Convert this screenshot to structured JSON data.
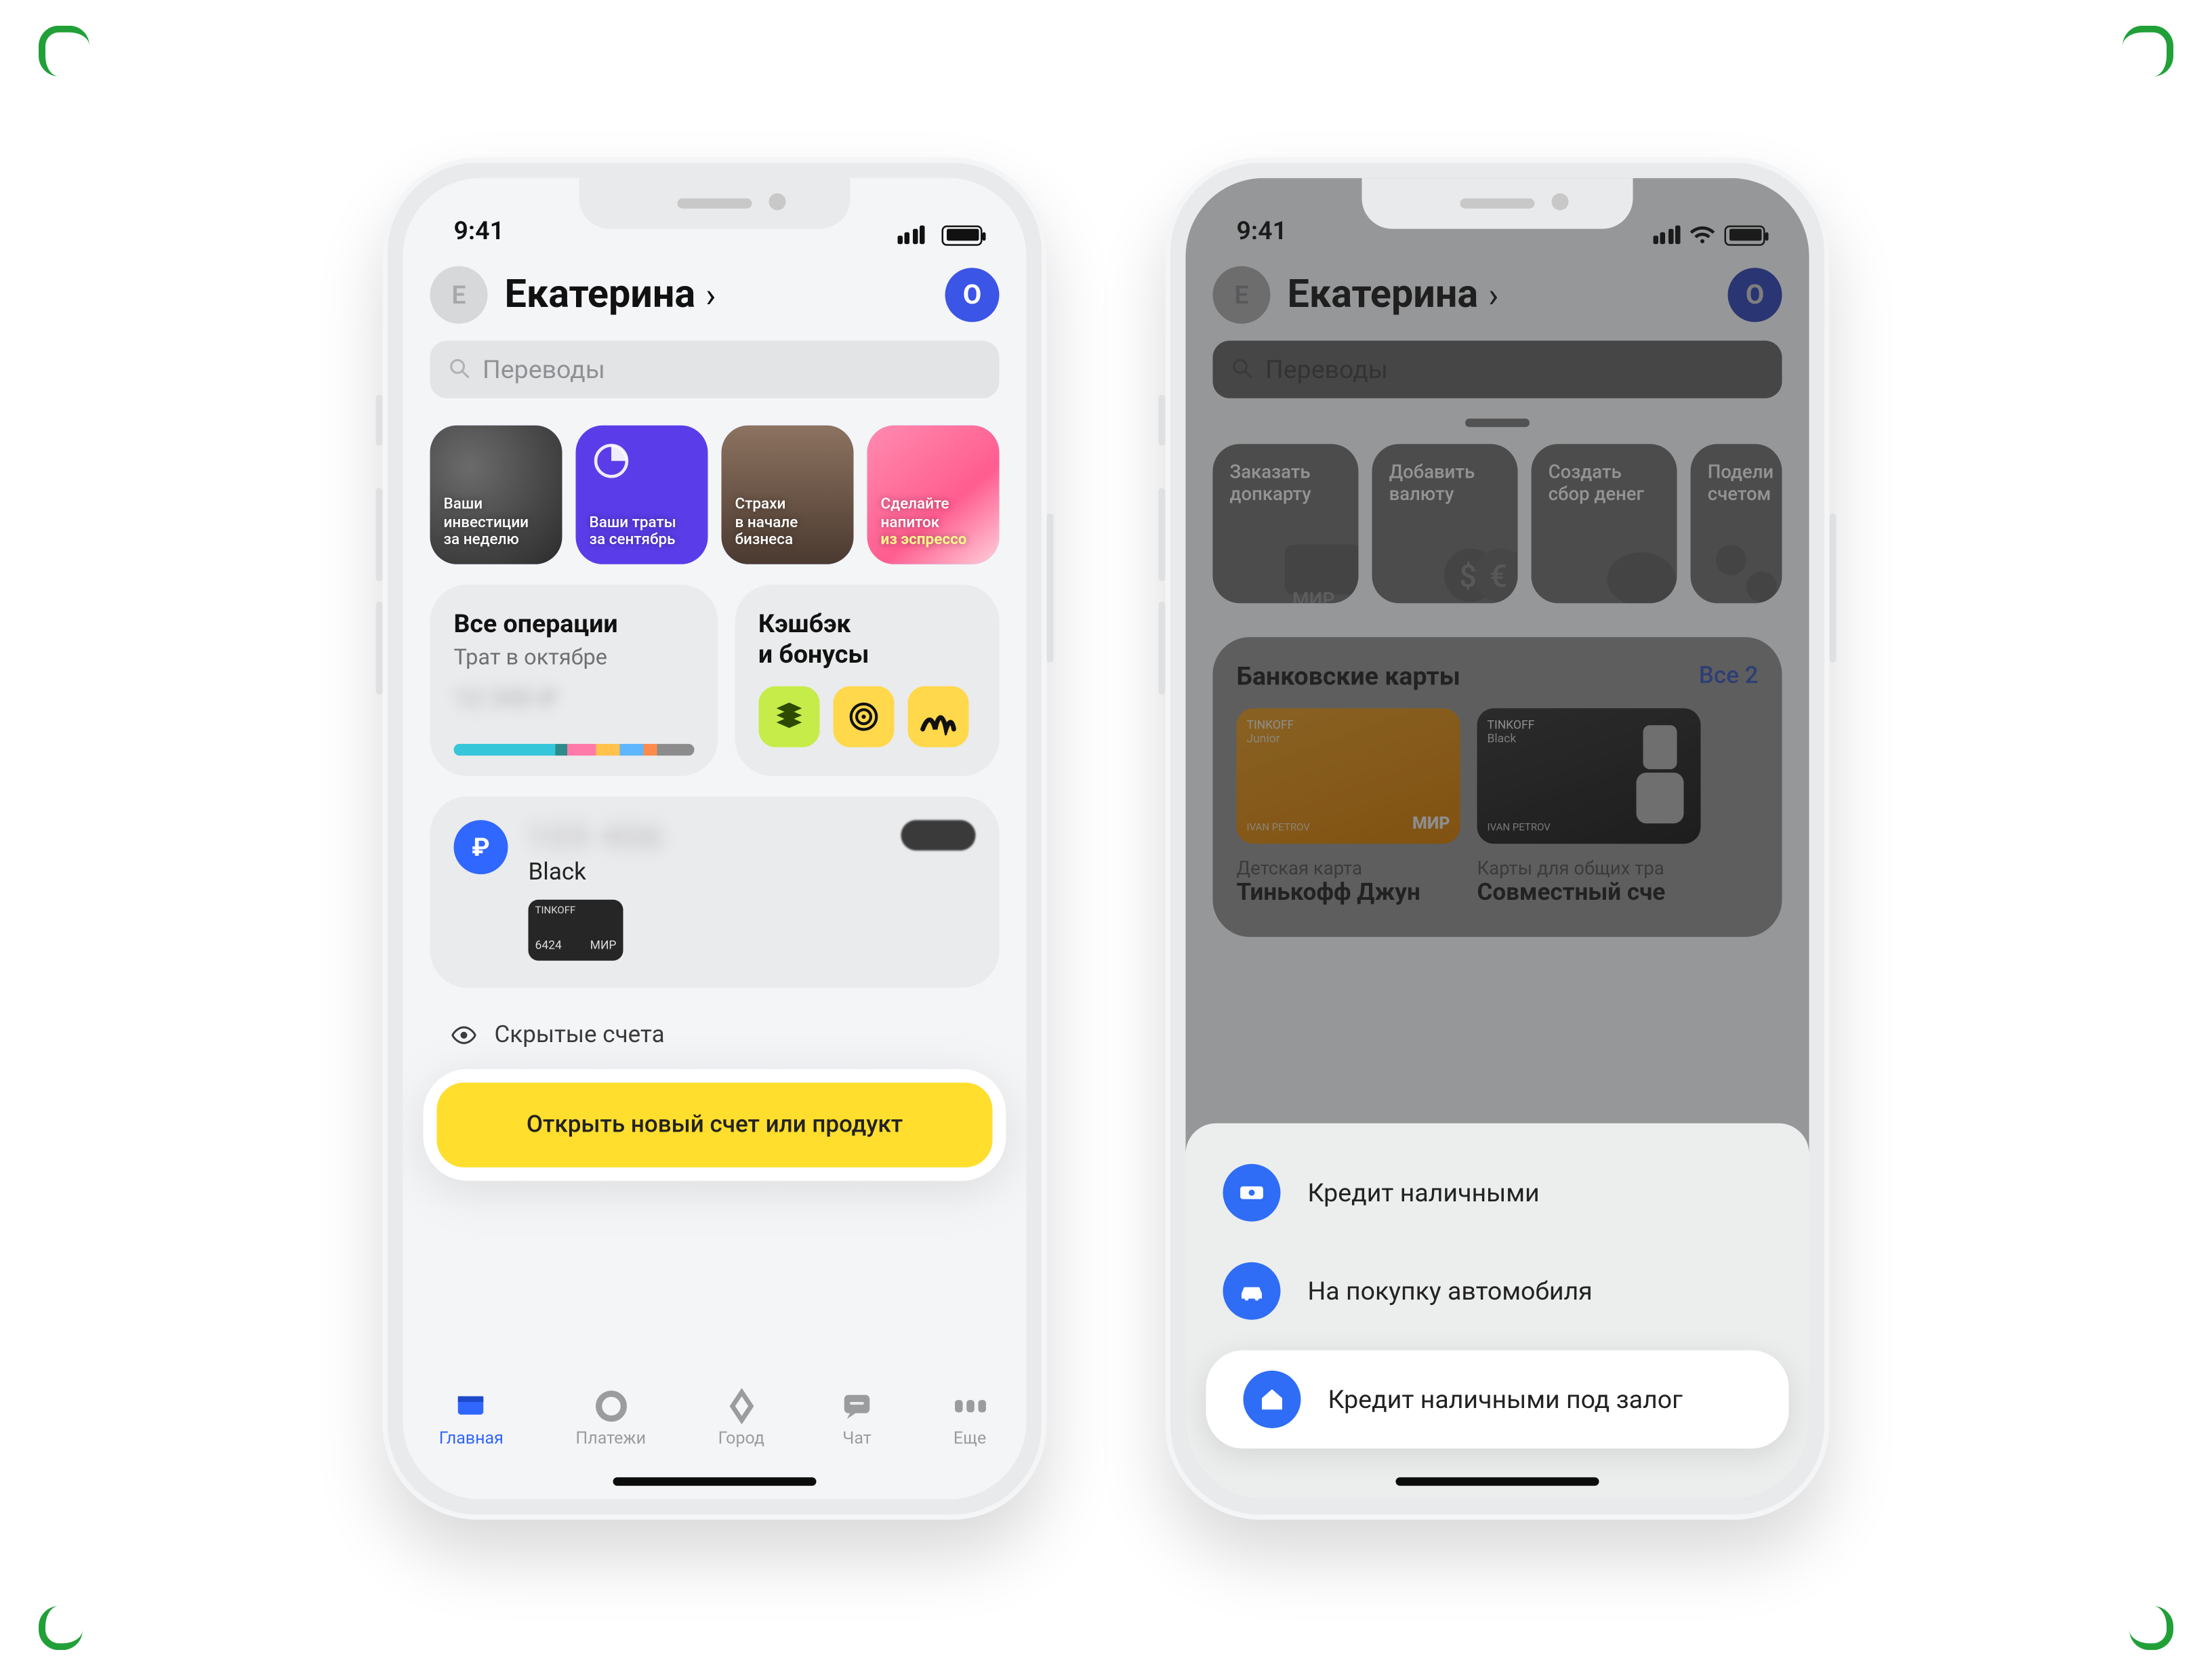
{
  "status": {
    "time": "9:41"
  },
  "header": {
    "avatar_initial": "Е",
    "user_name": "Екатерина",
    "badge_letter": "О",
    "search_placeholder": "Переводы"
  },
  "stories": [
    {
      "line1": "Ваши",
      "line2": "инвестиции",
      "line3": "за неделю"
    },
    {
      "line1": "Ваши траты",
      "line2": "за сентябрь"
    },
    {
      "line1": "Страхи",
      "line2": "в начале",
      "line3": "бизнеса"
    },
    {
      "line1": "Сделайте",
      "line2": "напиток",
      "line3_hl": "из эспрессо"
    }
  ],
  "ops_card": {
    "title": "Все операции",
    "subtitle": "Трат в октябре",
    "amount_masked": "12 345 ₽",
    "segments": [
      {
        "color": "#35c6d9",
        "w": 42
      },
      {
        "color": "#2f8a8a",
        "w": 5
      },
      {
        "color": "#ff7aa8",
        "w": 12
      },
      {
        "color": "#ffc24b",
        "w": 10
      },
      {
        "color": "#5db6ff",
        "w": 10
      },
      {
        "color": "#ff8b4b",
        "w": 6
      },
      {
        "color": "#8c8c8c",
        "w": 15
      }
    ]
  },
  "cashback_card": {
    "title_l1": "Кэшбэк",
    "title_l2": "и бонусы"
  },
  "account": {
    "name": "Black",
    "amount_masked": "123 456",
    "card_brand": "TINKOFF",
    "card_last4": "6424",
    "card_scheme": "МИР"
  },
  "hidden_accounts_label": "Скрытые счета",
  "cta_label": "Открыть новый счет или продукт",
  "tabs": [
    {
      "id": "home",
      "label": "Главная",
      "active": true
    },
    {
      "id": "payments",
      "label": "Платежи"
    },
    {
      "id": "city",
      "label": "Город"
    },
    {
      "id": "chat",
      "label": "Чат"
    },
    {
      "id": "more",
      "label": "Еще"
    }
  ],
  "phone2": {
    "actions": [
      {
        "l1": "Заказать",
        "l2": "допкарту"
      },
      {
        "l1": "Добавить",
        "l2": "валюту"
      },
      {
        "l1": "Создать",
        "l2": "сбор денег"
      },
      {
        "l1": "Подели",
        "l2": "счетом"
      }
    ],
    "cards_section": {
      "title": "Банковские карты",
      "all_label": "Все 2",
      "cards": [
        {
          "brand": "TINKOFF",
          "variant": "Junior",
          "holder": "IVAN PETROV",
          "scheme": "МИР",
          "subtitle": "Детская карта",
          "title": "Тинькофф Джун"
        },
        {
          "brand": "TINKOFF",
          "variant": "Black",
          "holder": "IVAN PETROV",
          "subtitle": "Карты для общих тра",
          "title": "Совместный сче"
        }
      ]
    },
    "sheet": [
      {
        "icon": "cash",
        "label": "Кредит наличными"
      },
      {
        "icon": "car",
        "label": "На покупку автомобиля"
      },
      {
        "icon": "house",
        "label": "Кредит наличными под залог",
        "highlight": true
      }
    ]
  }
}
